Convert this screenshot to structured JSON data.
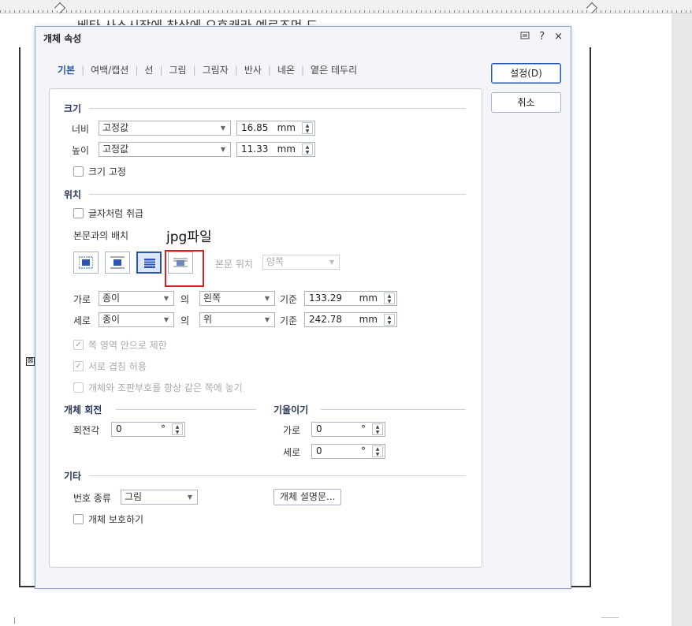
{
  "document": {
    "background_text": "베타 사스시장에 착상에 오후캐라 예로즈먼 드"
  },
  "dialog": {
    "title": "개체 속성",
    "titlebar_icons": [
      "restore-icon",
      "help-icon",
      "close-icon"
    ],
    "help_glyph": "?",
    "close_glyph": "×",
    "tabs": [
      "기본",
      "여백/캡션",
      "선",
      "그림",
      "그림자",
      "반사",
      "네온",
      "옅은 테두리"
    ],
    "active_tab": "기본",
    "buttons": {
      "ok": "설정(D)",
      "cancel": "취소"
    },
    "size": {
      "title": "크기",
      "width_label": "너비",
      "width_mode": "고정값",
      "width_value": "16.85",
      "height_label": "높이",
      "height_mode": "고정값",
      "height_value": "11.33",
      "unit": "mm",
      "lock_label": "크기 고정",
      "lock_checked": false
    },
    "position": {
      "title": "위치",
      "treat_as_char_label": "글자처럼 취급",
      "treat_as_char_checked": false,
      "wrap_label": "본문과의 배치",
      "wrap_options": [
        "wrap-square-icon",
        "wrap-top-bottom-icon",
        "wrap-behind-text-icon",
        "wrap-in-front-icon"
      ],
      "wrap_selected_index": 2,
      "text_position_label": "본문 위치",
      "text_position_value": "양쪽",
      "horizontal_label": "가로",
      "horizontal_ref": "종이",
      "horizontal_of": "의",
      "horizontal_align": "왼쪽",
      "horizontal_base_label": "기준",
      "horizontal_value": "133.29",
      "vertical_label": "세로",
      "vertical_ref": "종이",
      "vertical_of": "의",
      "vertical_align": "위",
      "vertical_base_label": "기준",
      "vertical_value": "242.78",
      "unit": "mm",
      "limit_label": "쪽 영역 안으로 제한",
      "limit_checked": true,
      "overlap_label": "서로 겹침 허용",
      "overlap_checked": true,
      "same_page_label": "개체와 조판부호를 항상 같은 쪽에 놓기",
      "same_page_checked": false
    },
    "rotation": {
      "title": "개체 회전",
      "angle_label": "회전각",
      "angle_value": "0",
      "unit": "°"
    },
    "skew": {
      "title": "기울이기",
      "h_label": "가로",
      "h_value": "0",
      "v_label": "세로",
      "v_value": "0",
      "unit": "°"
    },
    "etc": {
      "title": "기타",
      "number_type_label": "번호 종류",
      "number_type_value": "그림",
      "description_button": "개체 설명문...",
      "protect_label": "개체 보호하기",
      "protect_checked": false
    }
  },
  "annotation": {
    "text": "jpg파일",
    "color": "#d22020"
  },
  "colors": {
    "accent": "#2a55b5",
    "highlight": "#d22020"
  }
}
